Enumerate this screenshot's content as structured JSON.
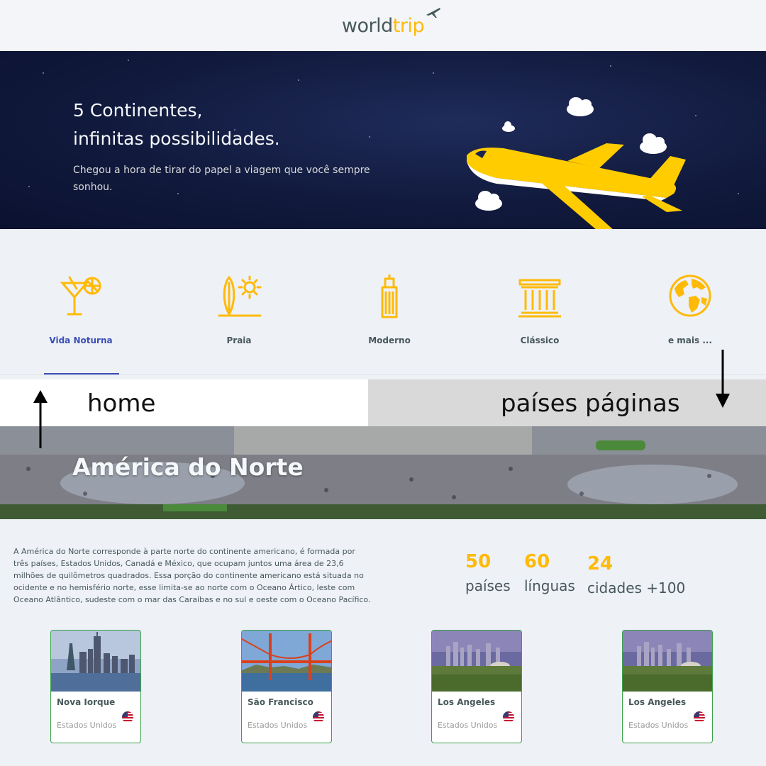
{
  "header": {
    "logo_world": "world",
    "logo_trip": "trip"
  },
  "hero": {
    "title_line1": "5 Continentes,",
    "title_line2": "infinitas possibilidades.",
    "subtitle": "Chegou a hora de tirar do papel a viagem que você sempre sonhou."
  },
  "categories": [
    {
      "label": "Vida Noturna",
      "icon": "cocktail-icon",
      "active": true
    },
    {
      "label": "Praia",
      "icon": "surfboard-sun-icon",
      "active": false
    },
    {
      "label": "Moderno",
      "icon": "skyscraper-icon",
      "active": false
    },
    {
      "label": "Clássico",
      "icon": "classical-building-icon",
      "active": false
    },
    {
      "label": "e mais ...",
      "icon": "globe-icon",
      "active": false
    }
  ],
  "annotations": {
    "left": "home",
    "right": "países páginas"
  },
  "continent": {
    "title": "América do Norte",
    "description": "A América do Norte corresponde à parte norte do continente americano, é formada por três países, Estados Unidos, Canadá e México, que ocupam juntos uma área de 23,6 milhões de quilômetros quadrados. Essa porção do continente americano está situada no ocidente e no hemisfério norte, esse limita-se ao norte com o Oceano Ártico, leste com Oceano Atlântico, sudeste com o mar das Caraíbas e no sul e oeste com o Oceano Pacífico."
  },
  "stats": [
    {
      "value": "50",
      "label": "países"
    },
    {
      "value": "60",
      "label": "línguas"
    },
    {
      "value": "24",
      "label": "cidades +100"
    }
  ],
  "cities": [
    {
      "name": "Nova Iorque",
      "country": "Estados Unidos"
    },
    {
      "name": "São Francisco",
      "country": "Estados Unidos"
    },
    {
      "name": "Los Angeles",
      "country": "Estados Unidos"
    },
    {
      "name": "Los Angeles",
      "country": "Estados Unidos"
    }
  ],
  "colors": {
    "accent": "#ffba08",
    "active": "#3b4fb6",
    "text": "#47585b",
    "card_border": "#3aa24a"
  }
}
